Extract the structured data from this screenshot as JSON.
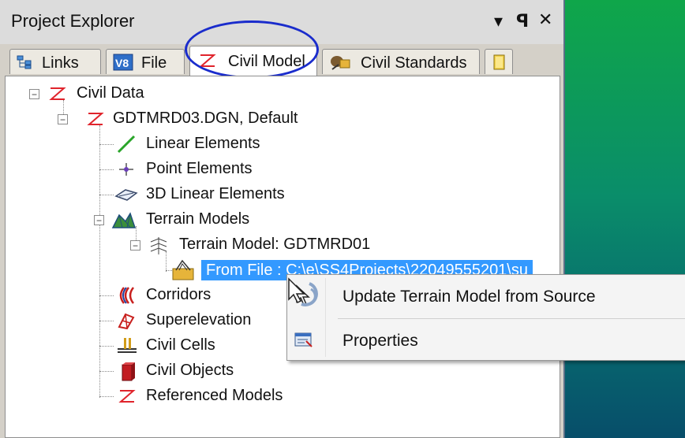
{
  "window": {
    "title": "Project Explorer",
    "dropdown_glyph": "▾",
    "pin_glyph": "ᵽ",
    "close_glyph": "✕"
  },
  "tabs": [
    {
      "label": "Links",
      "icon": "links-icon"
    },
    {
      "label": "File",
      "icon": "v8-file-icon",
      "icon_text": "V8"
    },
    {
      "label": "Civil Model",
      "icon": "civil-z-icon",
      "active": true
    },
    {
      "label": "Civil Standards",
      "icon": "civil-standards-icon"
    }
  ],
  "tab_scroll": {
    "left": "◂",
    "right": "▸"
  },
  "tree": {
    "root": {
      "label": "Civil Data",
      "expander": "−"
    },
    "file": {
      "label": "GDTMRD03.DGN, Default",
      "expander": "−"
    },
    "linear": {
      "label": "Linear Elements"
    },
    "point": {
      "label": "Point Elements"
    },
    "linear3d": {
      "label": "3D Linear Elements"
    },
    "terrain_models": {
      "label": "Terrain Models",
      "expander": "−"
    },
    "terrain_model": {
      "label": "Terrain Model: GDTMRD01",
      "expander": "−"
    },
    "from_file": {
      "label": "From File : C:\\e\\SS4Projects\\22049555201\\su"
    },
    "corridors": {
      "label": "Corridors"
    },
    "superelevation": {
      "label": "Superelevation"
    },
    "civil_cells": {
      "label": "Civil Cells"
    },
    "civil_objects": {
      "label": "Civil Objects"
    },
    "referenced": {
      "label": "Referenced Models"
    }
  },
  "context_menu": {
    "items": [
      {
        "label": "Update Terrain Model from Source",
        "icon": "update-terrain-icon"
      },
      {
        "label": "Properties",
        "icon": "properties-icon"
      }
    ]
  },
  "colors": {
    "selection": "#3399ff",
    "civil_z": "#e0242c",
    "highlight_oval": "#1a2ccc"
  }
}
